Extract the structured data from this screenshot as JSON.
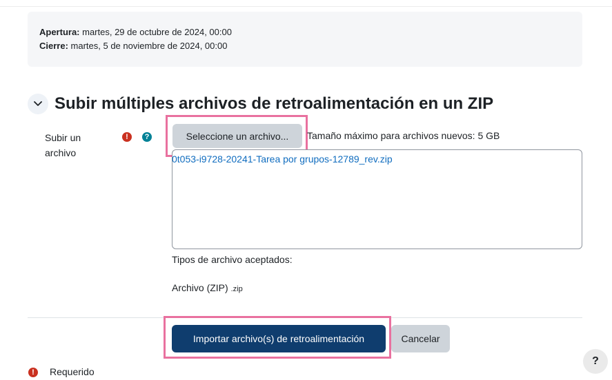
{
  "dates": {
    "opening_label": "Apertura:",
    "opening_value": " martes, 29 de octubre de 2024, 00:00",
    "closing_label": "Cierre:",
    "closing_value": " martes, 5 de noviembre de 2024, 00:00"
  },
  "section": {
    "title": "Subir múltiples archivos de retroalimentación en un ZIP",
    "toggle_icon": "chevron-down-icon"
  },
  "upload": {
    "label": "Subir un archivo",
    "required_icon": "!",
    "help_icon": "?",
    "select_button": "Seleccione un archivo...",
    "max_size": "Tamaño máximo para archivos nuevos: 5 GB",
    "file_name": "0t053-i9728-20241-Tarea por grupos-12789_rev.zip",
    "accepted_label": "Tipos de archivo aceptados:",
    "accepted_type": "Archivo (ZIP) ",
    "accepted_ext": ".zip"
  },
  "actions": {
    "import_button": "Importar archivo(s) de retroalimentación",
    "cancel_button": "Cancelar"
  },
  "footer": {
    "required_label": "Requerido",
    "help_fab": "?"
  },
  "colors": {
    "primary": "#0f3d6e",
    "secondary": "#ced4da",
    "highlight": "#e9719f",
    "required": "#ca3120",
    "help": "#008196",
    "link": "#0f6cbf"
  }
}
